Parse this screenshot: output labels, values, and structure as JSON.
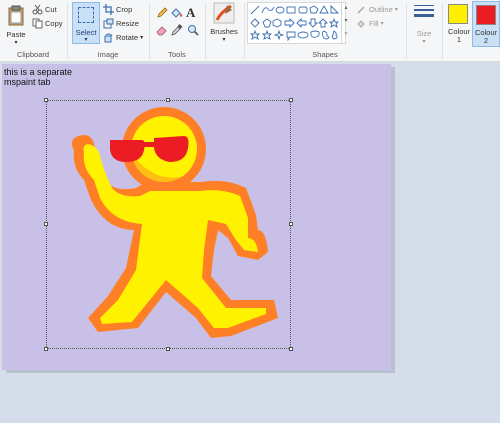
{
  "ribbon": {
    "clipboard": {
      "paste_label": "Paste",
      "cut_label": "Cut",
      "copy_label": "Copy",
      "group_label": "Clipboard"
    },
    "image": {
      "select_label": "Select",
      "crop_label": "Crop",
      "resize_label": "Resize",
      "rotate_label": "Rotate",
      "group_label": "Image"
    },
    "tools": {
      "group_label": "Tools",
      "text_tool_glyph": "A"
    },
    "brushes": {
      "label": "Brushes"
    },
    "shapes": {
      "outline_label": "Outline",
      "fill_label": "Fill",
      "group_label": "Shapes"
    },
    "size": {
      "label": "Size"
    },
    "colours": {
      "colour1_label": "Colour 1",
      "colour2_label": "Colour 2",
      "colour1_value": "#ffee00",
      "colour2_value": "#ec1c24"
    }
  },
  "canvas": {
    "text_line1": "this is a separate",
    "text_line2": "mspaint tab",
    "background": "#c8c0e6"
  },
  "figure": {
    "body_color": "#fff200",
    "outline_color": "#ff7f27",
    "glasses_color": "#ec1c24"
  }
}
